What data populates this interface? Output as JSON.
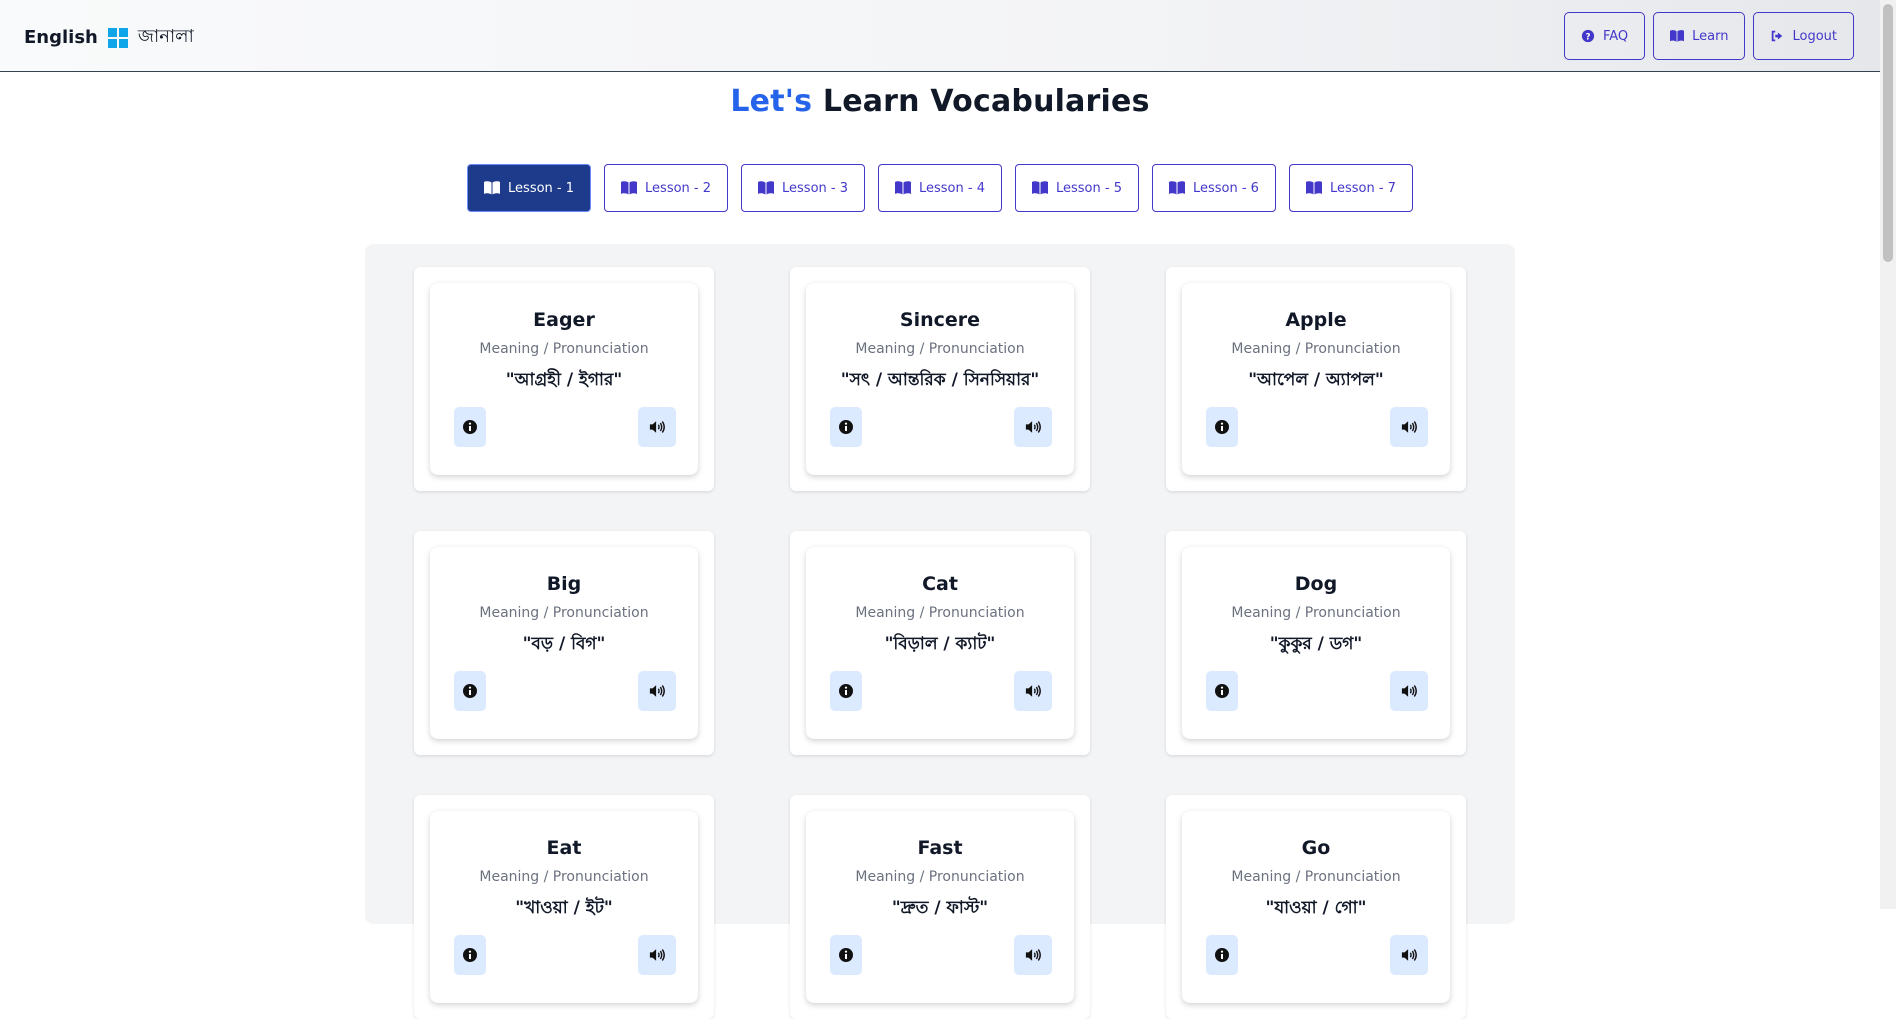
{
  "brand": {
    "lang": "English",
    "name": "জানালা"
  },
  "nav": [
    {
      "label": "FAQ",
      "icon": "question-circle-icon"
    },
    {
      "label": "Learn",
      "icon": "book-open-icon"
    },
    {
      "label": "Logout",
      "icon": "logout-icon"
    }
  ],
  "heading": {
    "accent": "Let's",
    "rest": "Learn Vocabularies"
  },
  "lessons": [
    {
      "label": "Lesson - 1",
      "active": true
    },
    {
      "label": "Lesson - 2",
      "active": false
    },
    {
      "label": "Lesson - 3",
      "active": false
    },
    {
      "label": "Lesson - 4",
      "active": false
    },
    {
      "label": "Lesson - 5",
      "active": false
    },
    {
      "label": "Lesson - 6",
      "active": false
    },
    {
      "label": "Lesson - 7",
      "active": false
    }
  ],
  "cards": [
    {
      "word": "Eager",
      "subtitle": "Meaning / Pronunciation",
      "meaning": "\"আগ্রহী / ইগার\""
    },
    {
      "word": "Sincere",
      "subtitle": "Meaning / Pronunciation",
      "meaning": "\"সৎ / আন্তরিক / সিনসিয়ার\""
    },
    {
      "word": "Apple",
      "subtitle": "Meaning / Pronunciation",
      "meaning": "\"আপেল / অ্যাপল\""
    },
    {
      "word": "Big",
      "subtitle": "Meaning / Pronunciation",
      "meaning": "\"বড় / বিগ\""
    },
    {
      "word": "Cat",
      "subtitle": "Meaning / Pronunciation",
      "meaning": "\"বিড়াল / ক্যাট\""
    },
    {
      "word": "Dog",
      "subtitle": "Meaning / Pronunciation",
      "meaning": "\"কুকুর / ডগ\""
    },
    {
      "word": "Eat",
      "subtitle": "Meaning / Pronunciation",
      "meaning": "\"খাওয়া / ইট\""
    },
    {
      "word": "Fast",
      "subtitle": "Meaning / Pronunciation",
      "meaning": "\"দ্রুত / ফাস্ট\""
    },
    {
      "word": "Go",
      "subtitle": "Meaning / Pronunciation",
      "meaning": "\"যাওয়া / গো\""
    }
  ],
  "colors": {
    "accent": "#2563eb",
    "primary": "#4338ca",
    "active_lesson": "#1e3a8a",
    "icon_button_bg": "#dbeafe"
  }
}
